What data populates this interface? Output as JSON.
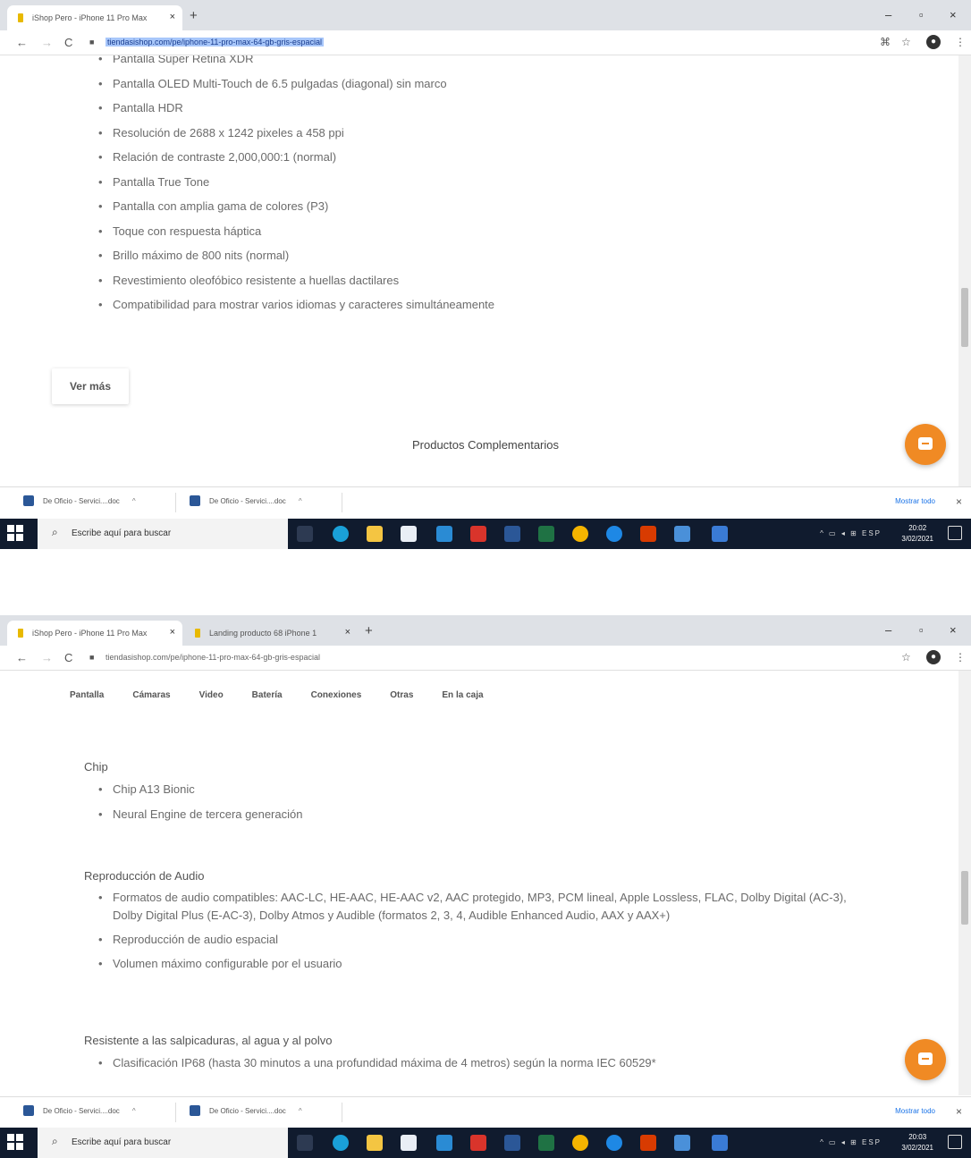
{
  "shot1": {
    "tabs": [
      {
        "title": "iShop Pero - iPhone 11 Pro Max"
      }
    ],
    "url": "tiendasishop.com/pe/iphone-11-pro-max-64-gb-gris-espacial",
    "bullets": [
      "Pantalla Super Retina XDR",
      "Pantalla OLED Multi-Touch de 6.5 pulgadas (diagonal) sin marco",
      "Pantalla HDR",
      "Resolución de 2688 x 1242 pixeles a 458 ppi",
      "Relación de contraste 2,000,000:1 (normal)",
      "Pantalla True Tone",
      "Pantalla con amplia gama de colores (P3)",
      "Toque con respuesta háptica",
      "Brillo máximo de 800 nits (normal)",
      "Revestimiento oleofóbico resistente a huellas dactilares",
      "Compatibilidad para mostrar varios idiomas y caracteres simultáneamente"
    ],
    "ver_mas": "Ver más",
    "complementarios": "Productos Complementarios",
    "downloads": [
      "De Oficio - Servici....doc",
      "De Oficio - Servici....doc"
    ],
    "show_all": "Mostrar todo",
    "clock_time": "20:02",
    "clock_date": "3/02/2021"
  },
  "shot2": {
    "tabs": [
      {
        "title": "iShop Pero - iPhone 11 Pro Max"
      },
      {
        "title": "Landing producto 68 iPhone 1"
      }
    ],
    "url": "tiendasishop.com/pe/iphone-11-pro-max-64-gb-gris-espacial",
    "spec_tabs": [
      "Pantalla",
      "Cámaras",
      "Video",
      "Batería",
      "Conexiones",
      "Otras",
      "En la caja"
    ],
    "chip": {
      "heading": "Chip",
      "items": [
        "Chip A13 Bionic",
        "Neural Engine de tercera generación"
      ]
    },
    "audio": {
      "heading": "Reproducción de Audio",
      "items": [
        "Formatos de audio compatibles: AAC-LC, HE-AAC, HE-AAC v2, AAC protegido, MP3, PCM lineal, Apple Lossless, FLAC, Dolby Digital (AC-3), Dolby Digital Plus (E-AC-3), Dolby Atmos y Audible (formatos 2, 3, 4, Audible Enhanced Audio, AAX y AAX+)",
        "Reproducción de audio espacial",
        "Volumen máximo configurable por el usuario"
      ]
    },
    "resistance": {
      "heading": "Resistente a las salpicaduras, al agua y al polvo",
      "items": [
        "Clasificación IP68 (hasta 30 minutos a una profundidad máxima de 4 metros) según la norma IEC 60529*"
      ]
    },
    "downloads": [
      "De Oficio - Servici....doc",
      "De Oficio - Servici....doc"
    ],
    "show_all": "Mostrar todo",
    "clock_time": "20:03",
    "clock_date": "3/02/2021"
  },
  "taskbar": {
    "search_placeholder": "Escribe aquí para buscar",
    "tray_lang": "ESP"
  },
  "colors": {
    "accent_fab": "#f08a24",
    "taskbar": "#101b2e",
    "url_selection": "#a8c7fa"
  }
}
